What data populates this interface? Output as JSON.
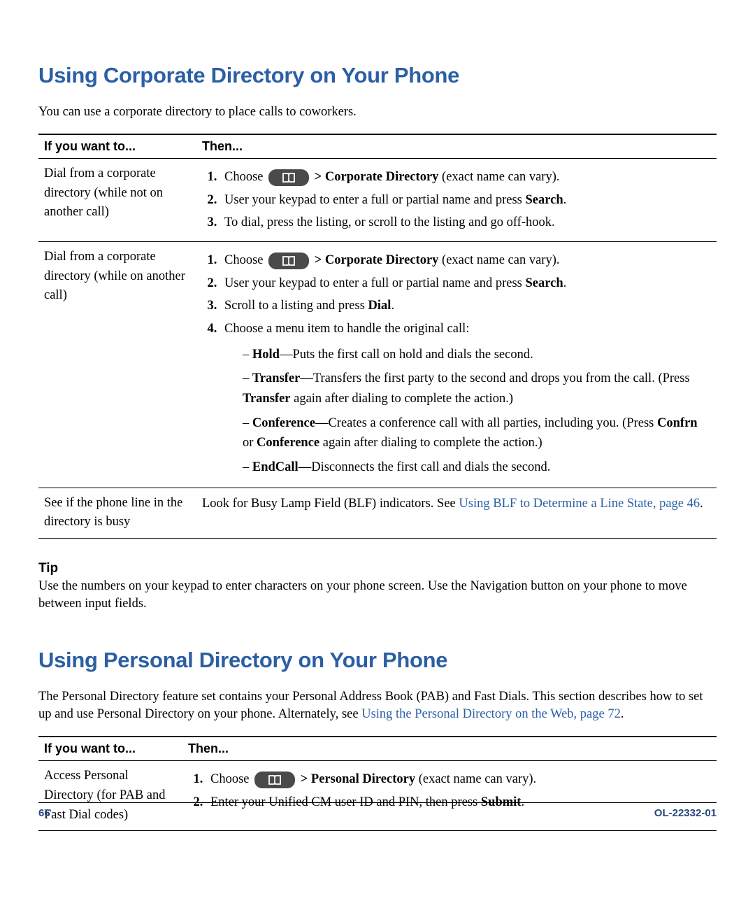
{
  "section1": {
    "heading": "Using Corporate Directory on Your Phone",
    "intro": "You can use a corporate directory to place calls to coworkers.",
    "cols": {
      "c1": "If you want to...",
      "c2": "Then..."
    },
    "row1": {
      "c1": "Dial from a corporate directory (while not on another call)",
      "s1a": "Choose ",
      "s1b": " > Corporate Directory",
      "s1c": " (exact name can vary).",
      "s2a": "User your keypad to enter a full or partial name and press ",
      "s2b": "Search",
      "s2c": ".",
      "s3": "To dial, press the listing, or scroll to the listing and go off-hook."
    },
    "row2": {
      "c1": "Dial from a corporate directory (while on another call)",
      "s1a": "Choose ",
      "s1b": " > Corporate Directory",
      "s1c": " (exact name can vary).",
      "s2a": "User your keypad to enter a full or partial name and press ",
      "s2b": "Search",
      "s2c": ".",
      "s3a": "Scroll to a listing and press ",
      "s3b": "Dial",
      "s3c": ".",
      "s4": "Choose a menu item to handle the original call:",
      "b1a": "Hold",
      "b1b": "—Puts the first call on hold and dials the second.",
      "b2a": "Transfer",
      "b2b": "—Transfers the first party to the second and drops you from the call. (Press ",
      "b2c": "Transfer",
      "b2d": " again after dialing to complete the action.)",
      "b3a": "Conference",
      "b3b": "—Creates a conference call with all parties, including you. (Press ",
      "b3c": "Confrn",
      "b3d": " or ",
      "b3e": "Conference",
      "b3f": " again after dialing to complete the action.)",
      "b4a": "EndCall",
      "b4b": "—Disconnects the first call and dials the second."
    },
    "row3": {
      "c1": "See if the phone line in the directory is busy",
      "t1": "Look for Busy Lamp Field (BLF) indicators. See ",
      "link": "Using BLF to Determine a Line State, page 46",
      "t2": "."
    }
  },
  "tip": {
    "label": "Tip",
    "text": "Use the numbers on your keypad to enter characters on your phone screen. Use the Navigation button on your phone to move between input fields."
  },
  "section2": {
    "heading": "Using Personal Directory on Your Phone",
    "intro1": "The Personal Directory feature set contains your Personal Address Book (PAB) and Fast Dials. This section describes how to set up and use Personal Directory on your phone. Alternately, see ",
    "introLink": "Using the Personal Directory on the Web, page 72",
    "intro2": ".",
    "cols": {
      "c1": "If you want to...",
      "c2": "Then..."
    },
    "row1": {
      "c1": "Access Personal Directory (for PAB and Fast Dial codes)",
      "s1a": "Choose ",
      "s1b": " > Personal Directory",
      "s1c": " (exact name can vary).",
      "s2a": "Enter your Unified CM user ID and PIN, then press ",
      "s2b": "Submit",
      "s2c": "."
    }
  },
  "footer": {
    "page": "66",
    "docid": "OL-22332-01"
  }
}
